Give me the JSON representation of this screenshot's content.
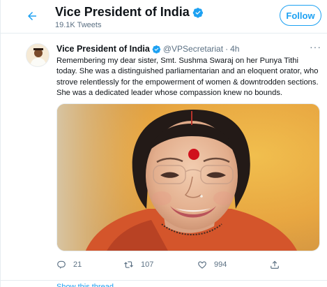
{
  "header": {
    "back_icon": "arrow-left-icon",
    "title": "Vice President of India",
    "subtitle": "19.1K Tweets",
    "follow_label": "Follow"
  },
  "tweet": {
    "author_name": "Vice President of India",
    "handle": "@VPSecretariat",
    "separator": "·",
    "time": "4h",
    "more_label": "···",
    "text": "Remembering my dear sister, Smt. Sushma Swaraj on her Punya Tithi today. She was a distinguished parliamentarian and an eloquent orator, who strove relentlessly for the empowerment of women & downtrodden sections. She was a dedicated leader whose compassion knew no bounds.",
    "reply_count": "21",
    "retweet_count": "107",
    "like_count": "994"
  },
  "footer": {
    "partial_text": "Show this thread"
  },
  "colors": {
    "accent": "#1da1f2",
    "verified": "#1da1f2",
    "secondary_text": "#5b7083"
  }
}
